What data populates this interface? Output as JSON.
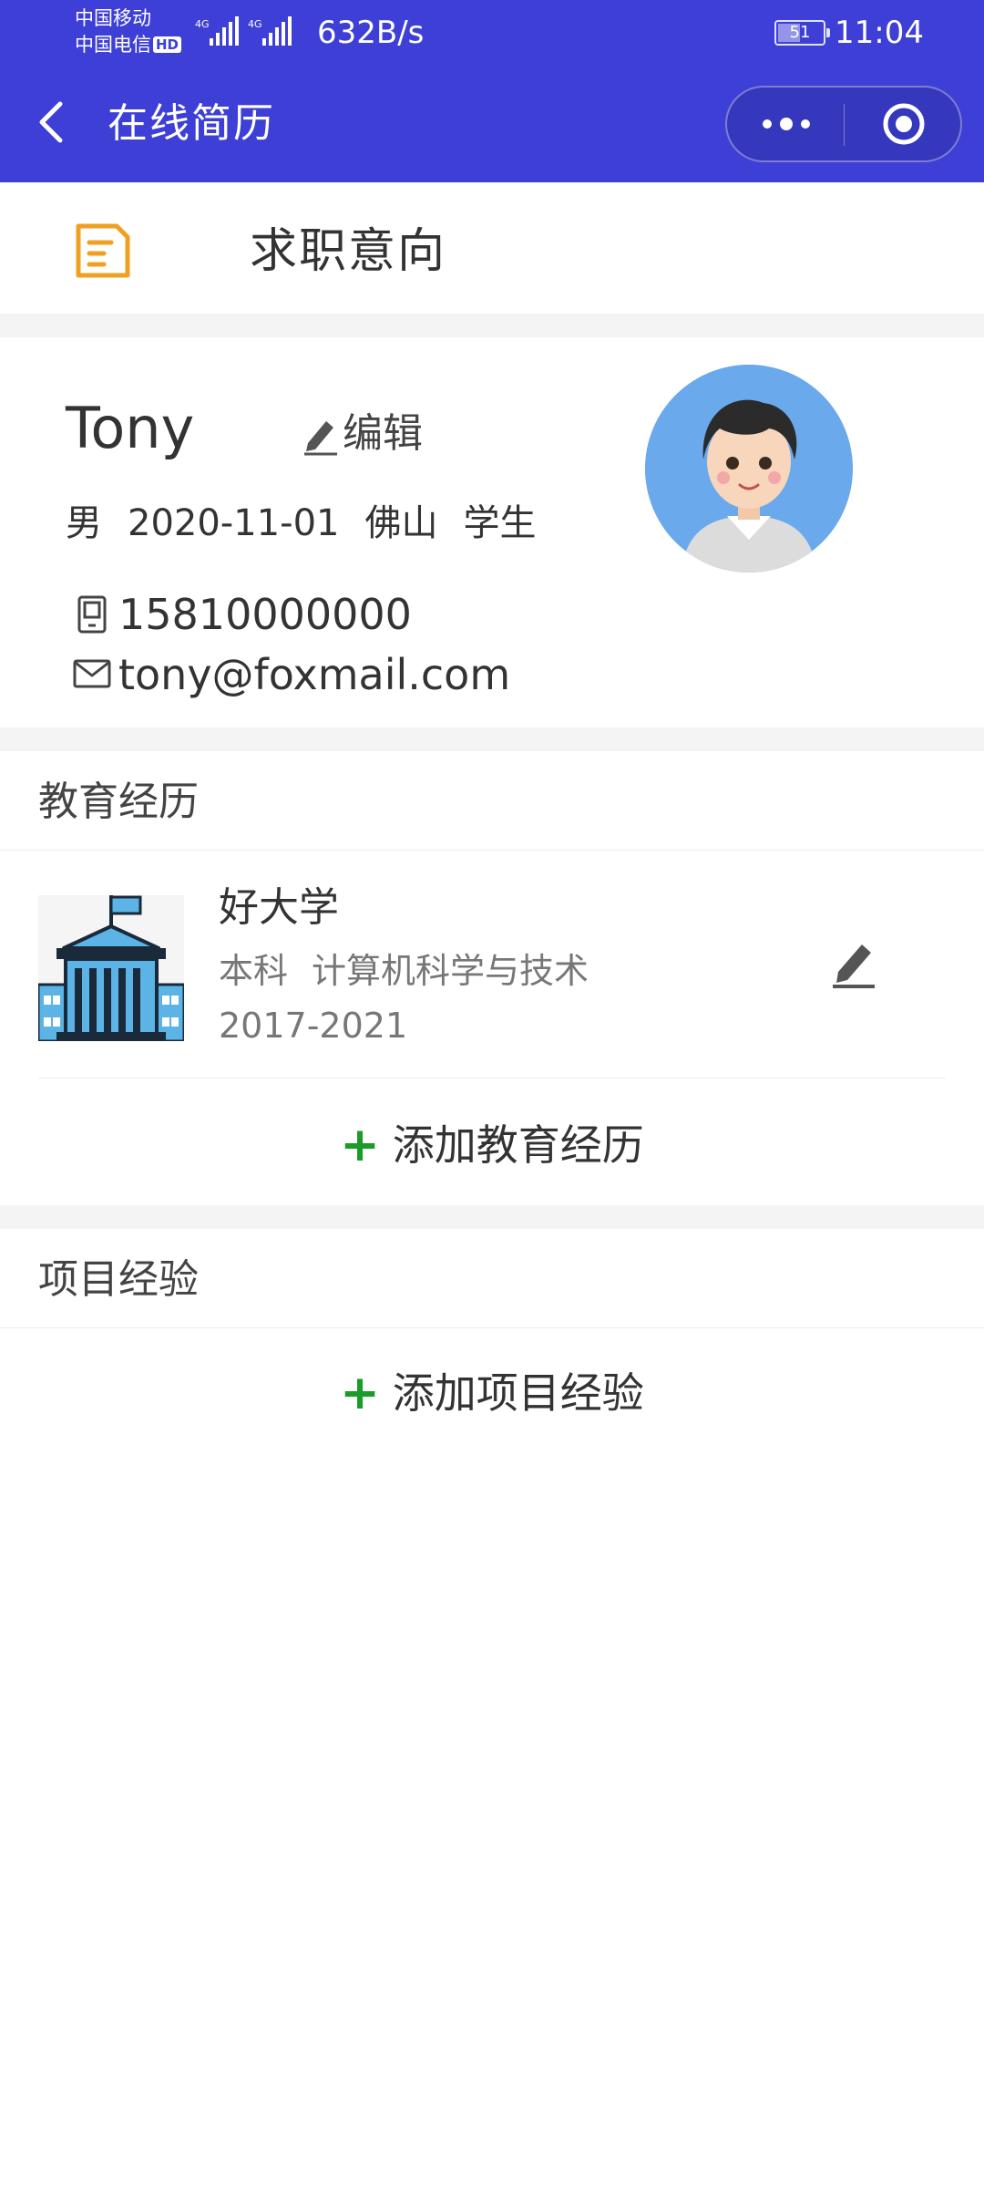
{
  "status_bar": {
    "carrier_1": "中国移动",
    "carrier_2": "中国电信",
    "carrier_2_badge": "HD",
    "net_speed": "632B/s",
    "battery": "51",
    "battery_level": 0.51,
    "time": "11:04"
  },
  "nav": {
    "back_icon": "chevron-left-icon",
    "title": "在线简历",
    "more_icon": "more-dots-icon",
    "close_icon": "target-circle-icon"
  },
  "intent": {
    "icon": "document-icon",
    "label": "求职意向"
  },
  "profile": {
    "name": "Tony",
    "edit_label": "编辑",
    "gender": "男",
    "birthday": "2020-11-01",
    "city": "佛山",
    "status": "学生",
    "phone": "15810000000",
    "email": "tony@foxmail.com"
  },
  "education": {
    "title": "教育经历",
    "items": [
      {
        "school": "好大学",
        "degree": "本科",
        "major": "计算机科学与技术",
        "years": "2017-2021"
      }
    ],
    "add_label": "添加教育经历"
  },
  "projects": {
    "title": "项目经验",
    "add_label": "添加项目经验"
  },
  "colors": {
    "nav_bg": "#3d3fd6",
    "accent_orange": "#f0a020",
    "add_green": "#1a9c2a"
  }
}
